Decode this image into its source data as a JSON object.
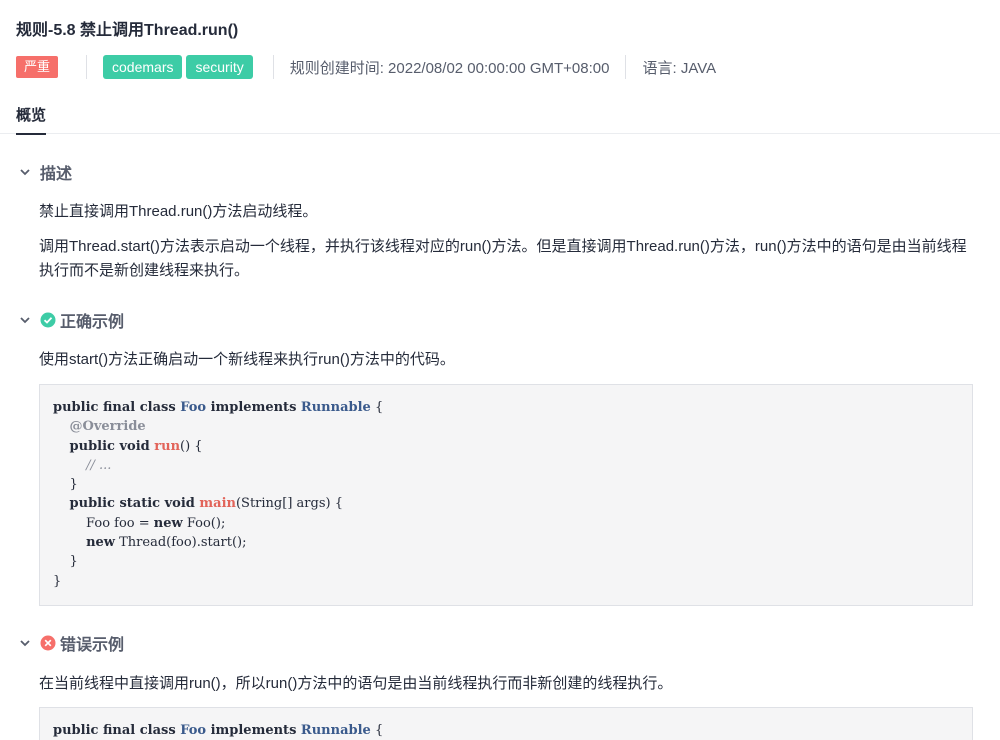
{
  "rule": {
    "title": "规则-5.8 禁止调用Thread.run()",
    "severity": "严重",
    "tags": [
      "codemars",
      "security"
    ],
    "created": "规则创建时间: 2022/08/02 00:00:00 GMT+08:00",
    "language": "语言: JAVA"
  },
  "tabs": {
    "overview": "概览"
  },
  "sections": {
    "description": {
      "title": "描述",
      "p1": "禁止直接调用Thread.run()方法启动线程。",
      "p2": "调用Thread.start()方法表示启动一个线程，并执行该线程对应的run()方法。但是直接调用Thread.run()方法，run()方法中的语句是由当前线程执行而不是新创建线程来执行。"
    },
    "correct": {
      "title": "正确示例",
      "p1": "使用start()方法正确启动一个新线程来执行run()方法中的代码。"
    },
    "wrong": {
      "title": "错误示例",
      "p1": "在当前线程中直接调用run()，所以run()方法中的语句是由当前线程执行而非新创建的线程执行。"
    }
  },
  "colors": {
    "severity": "#f66f6a",
    "tag": "#3dcca6",
    "correct_icon": "#3dcca6",
    "wrong_icon": "#f66f6a"
  }
}
